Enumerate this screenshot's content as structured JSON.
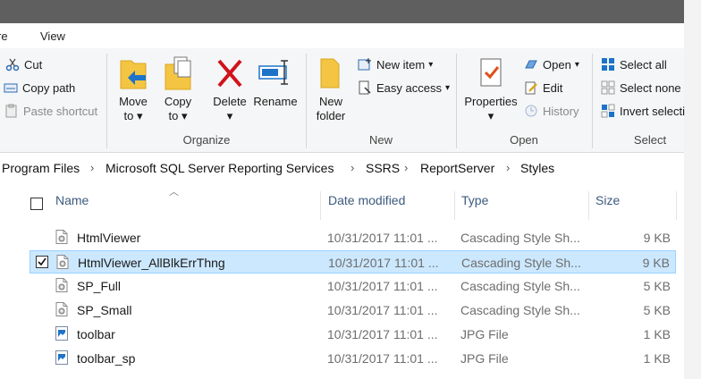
{
  "tabs": [
    "re",
    "View"
  ],
  "ribbon": {
    "clipboard": {
      "cut": "Cut",
      "copy_path": "Copy path",
      "paste_shortcut": "Paste shortcut"
    },
    "organize": {
      "move_to": [
        "Move",
        "to"
      ],
      "copy_to": [
        "Copy",
        "to"
      ],
      "delete": "Delete",
      "rename": "Rename",
      "label": "Organize"
    },
    "new": {
      "new_folder": [
        "New",
        "folder"
      ],
      "new_item": "New item",
      "easy_access": "Easy access",
      "label": "New"
    },
    "open": {
      "properties": "Properties",
      "open": "Open",
      "edit": "Edit",
      "history": "History",
      "label": "Open"
    },
    "select": {
      "select_all": "Select all",
      "select_none": "Select none",
      "invert": "Invert selecti",
      "label": "Select"
    }
  },
  "breadcrumb": [
    "Program Files",
    "Microsoft SQL Server Reporting Services",
    "SSRS",
    "ReportServer",
    "Styles"
  ],
  "columns": {
    "name": "Name",
    "date": "Date modified",
    "type": "Type",
    "size": "Size"
  },
  "files": [
    {
      "name": "HtmlViewer",
      "date": "10/31/2017 11:01 ...",
      "type": "Cascading Style Sh...",
      "size": "9 KB",
      "icon": "css-file-icon",
      "selected": false
    },
    {
      "name": "HtmlViewer_AllBlkErrThng",
      "date": "10/31/2017 11:01 ...",
      "type": "Cascading Style Sh...",
      "size": "9 KB",
      "icon": "css-file-icon",
      "selected": true
    },
    {
      "name": "SP_Full",
      "date": "10/31/2017 11:01 ...",
      "type": "Cascading Style Sh...",
      "size": "5 KB",
      "icon": "css-file-icon",
      "selected": false
    },
    {
      "name": "SP_Small",
      "date": "10/31/2017 11:01 ...",
      "type": "Cascading Style Sh...",
      "size": "5 KB",
      "icon": "css-file-icon",
      "selected": false
    },
    {
      "name": "toolbar",
      "date": "10/31/2017 11:01 ...",
      "type": "JPG File",
      "size": "1 KB",
      "icon": "jpg-file-icon",
      "selected": false
    },
    {
      "name": "toolbar_sp",
      "date": "10/31/2017 11:01 ...",
      "type": "JPG File",
      "size": "1 KB",
      "icon": "jpg-file-icon",
      "selected": false
    }
  ],
  "colors": {
    "accent": "#1e73c9",
    "selection_bg": "#cce8ff",
    "selection_border": "#99d1ff",
    "header_text": "#3c5a7e",
    "delete_red": "#d0141a"
  }
}
